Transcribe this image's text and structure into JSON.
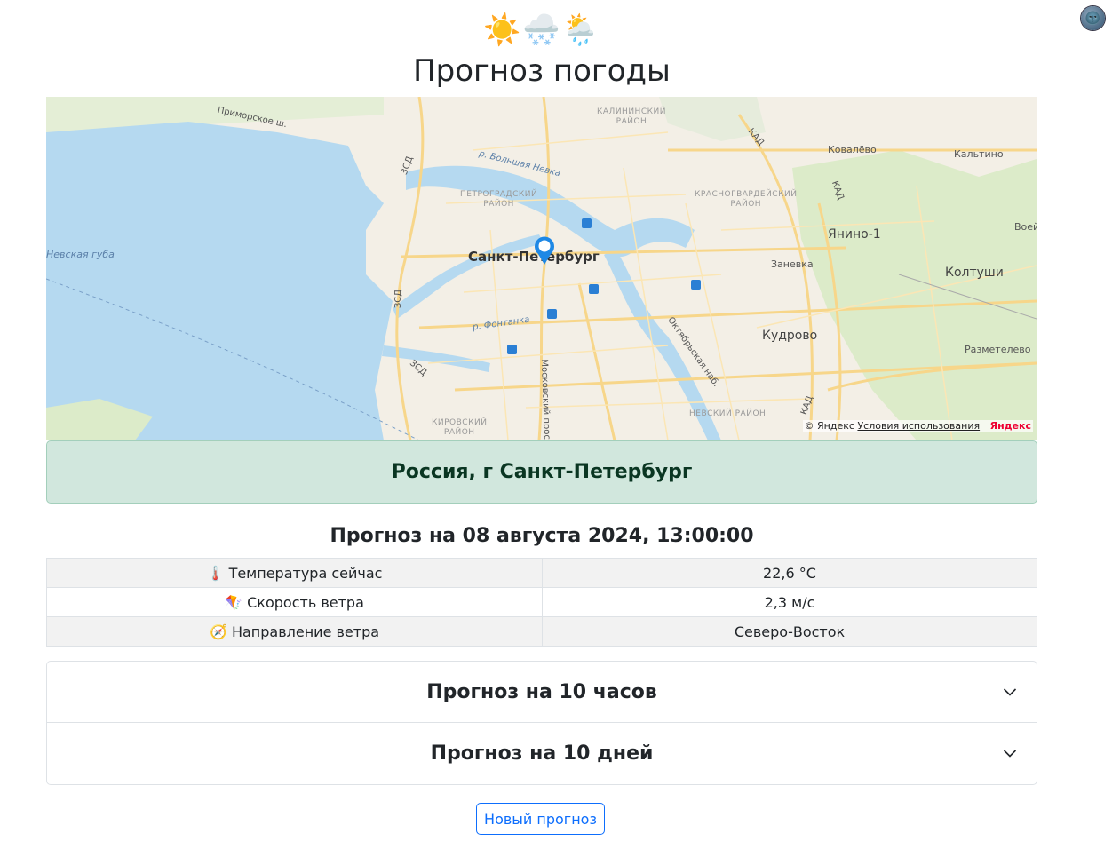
{
  "header": {
    "weather_icons": [
      "☀️",
      "🌨️",
      "🌦️"
    ],
    "title": "Прогноз погоды",
    "theme_toggle_icon": "🌚"
  },
  "map": {
    "city_label": "Санкт-Петербург",
    "labels": {
      "kalininsky": "КАЛИНИНСКИЙ\nРАЙОН",
      "petrogradsky": "ПЕТРОГРАДСКИЙ\nРАЙОН",
      "krasnogvardeysky": "КРАСНОГВАРДЕЙСКИЙ\nРАЙОН",
      "nevsky": "НЕВСКИЙ РАЙОН",
      "kirovsky": "КИРОВСКИЙ\nРАЙОН",
      "kovalevo": "Ковалёво",
      "kaltino": "Кальтино",
      "yanino": "Янино-1",
      "koltushi": "Колтуши",
      "zanevka": "Заневка",
      "kudrovo": "Кудрово",
      "razmetelevo": "Разметелево",
      "voe": "Воей",
      "nevskaya_guba": "Невская губа",
      "primorskoe": "Приморское ш.",
      "bolshaya_neva": "р. Большая Невка",
      "fontanka": "р. Фонтанка",
      "moskovsky": "Московский просп.",
      "oktyabrskaya": "Октябрьская наб.",
      "zsd1": "ЗСД",
      "zsd2": "ЗСД",
      "zsd3": "ЗСД",
      "kad1": "КАД",
      "kad2": "КАД",
      "kad3": "КАД"
    },
    "credit_prefix": "© Яндекс",
    "credit_terms": "Условия использования",
    "credit_brand": "Яндекс"
  },
  "location": "Россия, г Санкт-Петербург",
  "forecast": {
    "title": "Прогноз на 08 августа 2024, 13:00:00",
    "rows": [
      {
        "icon": "🌡️",
        "label": "Температура сейчас",
        "value": "22,6 °C"
      },
      {
        "icon": "🪁",
        "label": "Скорость ветра",
        "value": "2,3 м/с"
      },
      {
        "icon": "🧭",
        "label": "Направление ветра",
        "value": "Северо-Восток"
      }
    ]
  },
  "accordion": [
    {
      "label": "Прогноз на 10 часов"
    },
    {
      "label": "Прогноз на 10 дней"
    }
  ],
  "new_forecast_button": "Новый прогноз",
  "colors": {
    "success_bg": "#d1e7dd",
    "success_text": "#0a3622",
    "primary": "#0d6efd",
    "water": "#b5d9f0"
  }
}
